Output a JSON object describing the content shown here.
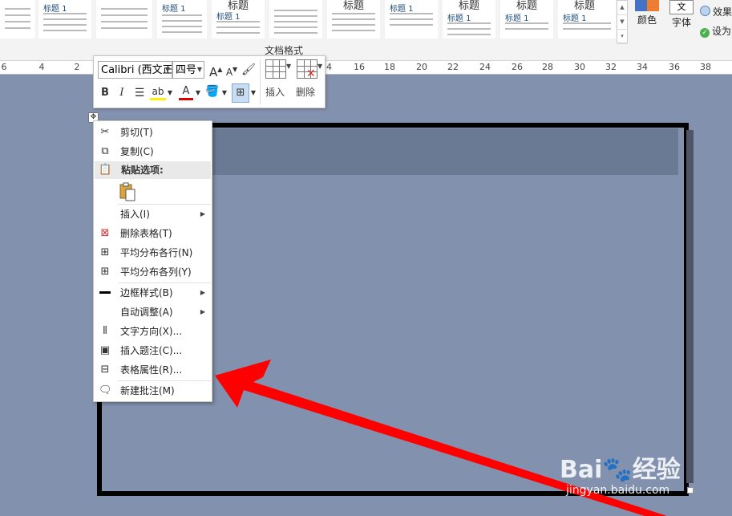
{
  "ribbon": {
    "group_label": "文档格式",
    "styles": [
      "标题 1",
      "标题",
      "标题 1",
      "标题",
      "标题",
      "标题 1",
      "标题",
      "标题",
      "标题"
    ],
    "colors_label": "颜色",
    "fonts_label": "字体",
    "fonts_glyph": "文",
    "effects_label": "效果",
    "set_default_label": "设为"
  },
  "ruler": {
    "numbers": [
      "6",
      "4",
      "2",
      "2",
      "4",
      "6",
      "8",
      "10",
      "12",
      "14",
      "16",
      "18",
      "20",
      "22",
      "24",
      "26",
      "28",
      "30",
      "32",
      "34",
      "36",
      "38"
    ]
  },
  "mini_toolbar": {
    "font_name": "Calibri (西文正",
    "font_size": "四号",
    "grow_font": "A",
    "shrink_font": "A",
    "bold": "B",
    "italic": "I",
    "highlight": "ab",
    "font_color": "A",
    "insert_label": "插入",
    "delete_label": "删除"
  },
  "context_menu": {
    "cut": "剪切(T)",
    "copy": "复制(C)",
    "paste_options": "粘贴选项:",
    "insert": "插入(I)",
    "delete_table": "删除表格(T)",
    "distribute_rows": "平均分布各行(N)",
    "distribute_cols": "平均分布各列(Y)",
    "border_style": "边框样式(B)",
    "autofit": "自动调整(A)",
    "text_direction": "文字方向(X)...",
    "insert_caption": "插入题注(C)...",
    "table_properties": "表格属性(R)...",
    "new_comment": "新建批注(M)"
  },
  "watermark": {
    "brand": "Bai🐾经验",
    "url": "jingyan.baidu.com"
  },
  "colors": {
    "arrow": "#ff0000",
    "page_bg": "#8291ad"
  }
}
